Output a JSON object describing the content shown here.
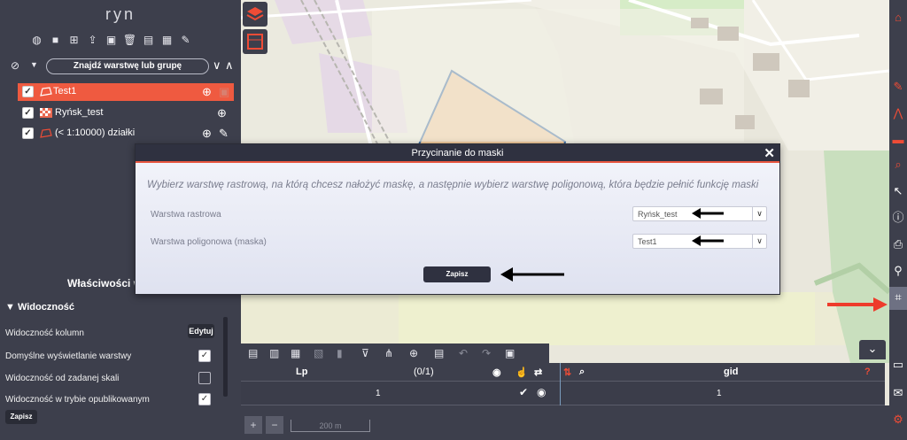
{
  "project": {
    "title": "ryn"
  },
  "left_panel": {
    "tools": [
      "globe-icon",
      "folder-icon",
      "add-icon",
      "upload-icon",
      "group-icon",
      "trash-icon",
      "chat-icon",
      "folder-plus-icon",
      "edit-icon"
    ],
    "find_label": "Znajdź warstwę lub grupę",
    "layers": [
      {
        "name": "Test1",
        "active": true,
        "checked": true
      },
      {
        "name": "Ryńsk_test",
        "active": false,
        "checked": true
      },
      {
        "name": "(< 1:10000) działki",
        "active": false,
        "checked": true
      }
    ],
    "properties_title": "Właściwości w",
    "visibility_section": "Widoczność",
    "visibility_columns_label": "Widoczność kolumn",
    "edit_label": "Edytuj",
    "props": [
      {
        "label": "Domyślne wyświetlanie warstwy",
        "checked": true
      },
      {
        "label": "Widoczność od zadanej skali",
        "checked": false
      },
      {
        "label": "Widoczność w trybie opublikowanym",
        "checked": true
      }
    ],
    "save_label": "Zapisz"
  },
  "modal": {
    "title": "Przycinanie do maski",
    "instruction": "Wybierz warstwę rastrową, na którą chcesz nałożyć maskę, a następnie wybierz warstwę poligonową, która będzie pełnić funkcję maski",
    "raster_label": "Warstwa rastrowa",
    "raster_value": "Ryńsk_test",
    "polygon_label": "Warstwa poligonowa (maska)",
    "polygon_value": "Test1",
    "save_label": "Zapisz"
  },
  "attr_table": {
    "col_lp": "Lp",
    "counter": "(0/1)",
    "col_gid": "gid",
    "help": "?",
    "row": {
      "lp": "1",
      "gid": "1"
    }
  },
  "map": {
    "scale_label": "200 m",
    "zoom_in": "+",
    "zoom_out": "−"
  },
  "colors": {
    "accent": "#ef5a40",
    "panel": "#3d3f4c",
    "red_toolbar": "#ee4c36"
  }
}
